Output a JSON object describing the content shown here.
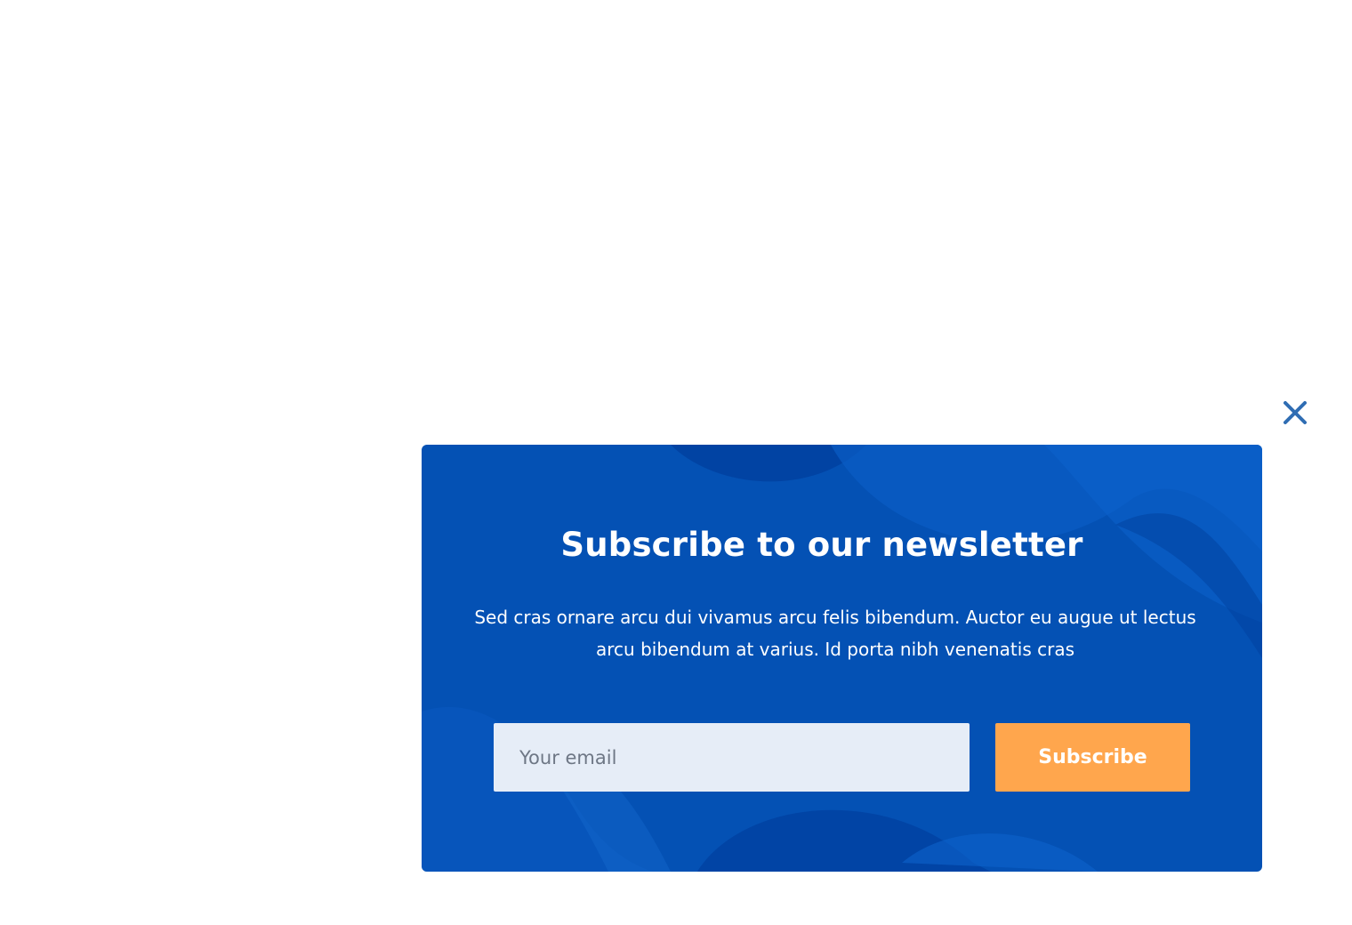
{
  "popup": {
    "close_icon": "close-icon",
    "title": "Subscribe to our newsletter",
    "description": "Sed cras ornare arcu dui vivamus arcu felis bibendum. Auctor eu augue ut lectus arcu bibendum at varius. Id porta nibh venenatis cras",
    "email_placeholder": "Your email",
    "email_value": "",
    "subscribe_label": "Subscribe"
  },
  "colors": {
    "card_background": "#0451b4",
    "close_icon": "#2f6db3",
    "input_background": "#e6edf7",
    "button_background": "#ffa64d",
    "text_on_card": "#ffffff"
  }
}
